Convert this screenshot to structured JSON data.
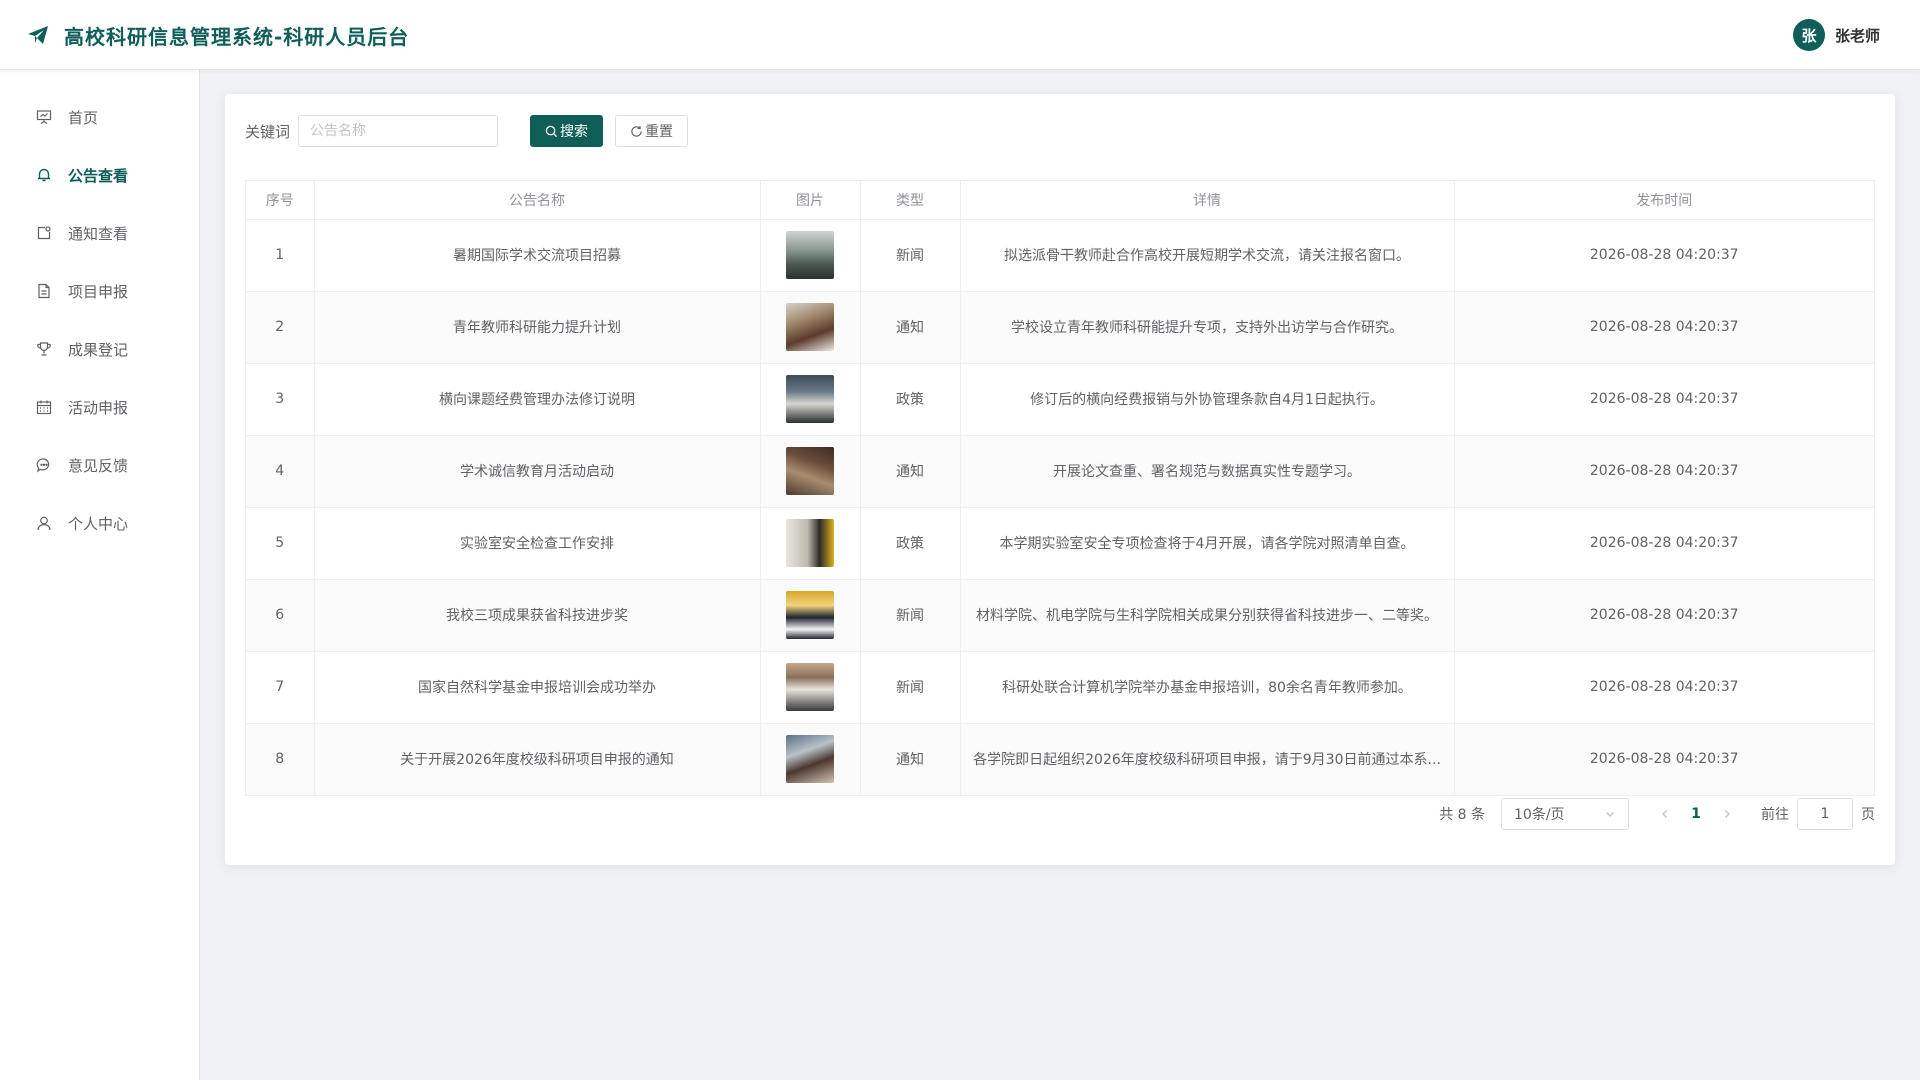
{
  "header": {
    "title": "高校科研信息管理系统-科研人员后台",
    "user_avatar_text": "张",
    "user_name": "张老师",
    "brand_color": "#0f5e57"
  },
  "sidebar": {
    "items": [
      {
        "label": "首页",
        "icon": "presentation-icon",
        "active": false
      },
      {
        "label": "公告查看",
        "icon": "bell-icon",
        "active": true
      },
      {
        "label": "通知查看",
        "icon": "notification-icon",
        "active": false
      },
      {
        "label": "项目申报",
        "icon": "document-icon",
        "active": false
      },
      {
        "label": "成果登记",
        "icon": "trophy-icon",
        "active": false
      },
      {
        "label": "活动申报",
        "icon": "calendar-icon",
        "active": false
      },
      {
        "label": "意见反馈",
        "icon": "chat-icon",
        "active": false
      },
      {
        "label": "个人中心",
        "icon": "user-icon",
        "active": false
      }
    ]
  },
  "search": {
    "label": "关键词",
    "placeholder": "公告名称",
    "value": "",
    "search_label": "搜索",
    "reset_label": "重置"
  },
  "table": {
    "columns": [
      "序号",
      "公告名称",
      "图片",
      "类型",
      "详情",
      "发布时间"
    ],
    "rows": [
      {
        "index": "1",
        "name": "暑期国际学术交流项目招募",
        "type": "新闻",
        "detail": "拟选派骨干教师赴合作高校开展短期学术交流，请关注报名窗口。",
        "time": "2026-08-28 04:20:37"
      },
      {
        "index": "2",
        "name": "青年教师科研能力提升计划",
        "type": "通知",
        "detail": "学校设立青年教师科研能提升专项，支持外出访学与合作研究。",
        "time": "2026-08-28 04:20:37"
      },
      {
        "index": "3",
        "name": "横向课题经费管理办法修订说明",
        "type": "政策",
        "detail": "修订后的横向经费报销与外协管理条款自4月1日起执行。",
        "time": "2026-08-28 04:20:37"
      },
      {
        "index": "4",
        "name": "学术诚信教育月活动启动",
        "type": "通知",
        "detail": "开展论文查重、署名规范与数据真实性专题学习。",
        "time": "2026-08-28 04:20:37"
      },
      {
        "index": "5",
        "name": "实验室安全检查工作安排",
        "type": "政策",
        "detail": "本学期实验室安全专项检查将于4月开展，请各学院对照清单自查。",
        "time": "2026-08-28 04:20:37"
      },
      {
        "index": "6",
        "name": "我校三项成果获省科技进步奖",
        "type": "新闻",
        "detail": "材料学院、机电学院与生科学院相关成果分别获得省科技进步一、二等奖。",
        "time": "2026-08-28 04:20:37"
      },
      {
        "index": "7",
        "name": "国家自然科学基金申报培训会成功举办",
        "type": "新闻",
        "detail": "科研处联合计算机学院举办基金申报培训，80余名青年教师参加。",
        "time": "2026-08-28 04:20:37"
      },
      {
        "index": "8",
        "name": "关于开展2026年度校级科研项目申报的通知",
        "type": "通知",
        "detail": "各学院即日起组织2026年度校级科研项目申报，请于9月30日前通过本系...",
        "time": "2026-08-28 04:20:37"
      }
    ]
  },
  "pagination": {
    "total_label": "共 8 条",
    "page_size": "10条/页",
    "current_page": "1",
    "goto_label": "前往",
    "goto_value": "1",
    "page_suffix": "页"
  }
}
